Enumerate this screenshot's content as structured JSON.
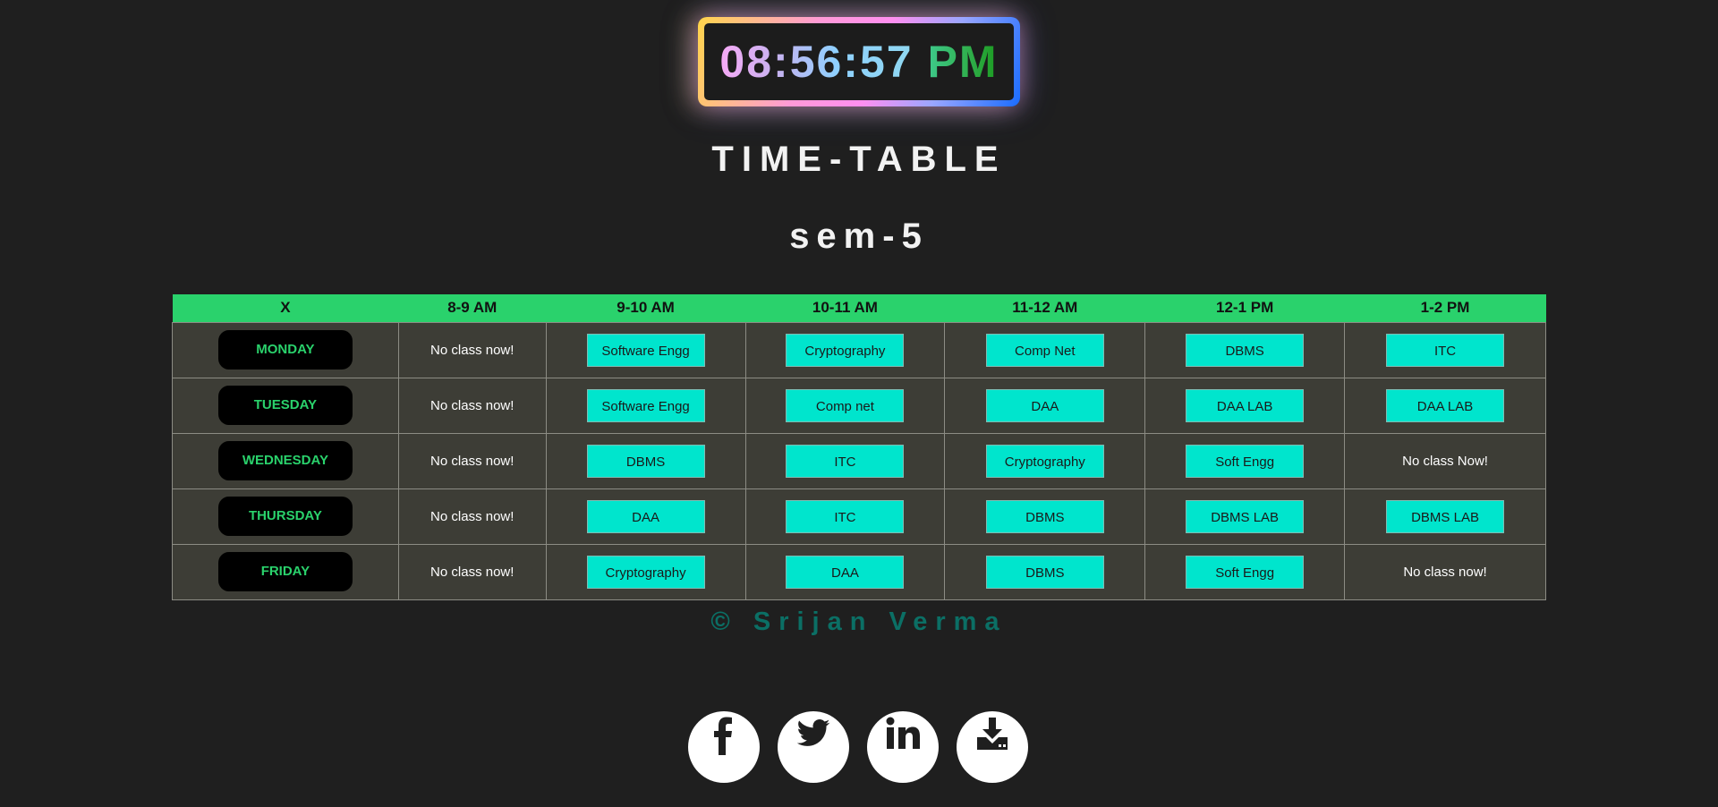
{
  "clock": {
    "time": "08:56:57",
    "ampm": "PM"
  },
  "title": "TIME-TABLE",
  "subtitle": "sem-5",
  "table": {
    "headers": [
      "X",
      "8-9 AM",
      "9-10 AM",
      "10-11 AM",
      "11-12 AM",
      "12-1 PM",
      "1-2 PM"
    ],
    "rows": [
      {
        "day": "MONDAY",
        "cells": [
          {
            "text": "No class now!",
            "type": "none"
          },
          {
            "text": "Software Engg",
            "type": "subject"
          },
          {
            "text": "Cryptography",
            "type": "subject"
          },
          {
            "text": "Comp Net",
            "type": "subject"
          },
          {
            "text": "DBMS",
            "type": "subject"
          },
          {
            "text": "ITC",
            "type": "subject"
          }
        ]
      },
      {
        "day": "TUESDAY",
        "cells": [
          {
            "text": "No class now!",
            "type": "none"
          },
          {
            "text": "Software Engg",
            "type": "subject"
          },
          {
            "text": "Comp net",
            "type": "subject"
          },
          {
            "text": "DAA",
            "type": "subject"
          },
          {
            "text": "DAA LAB",
            "type": "subject"
          },
          {
            "text": "DAA LAB",
            "type": "subject"
          }
        ]
      },
      {
        "day": "WEDNESDAY",
        "cells": [
          {
            "text": "No class now!",
            "type": "none"
          },
          {
            "text": "DBMS",
            "type": "subject"
          },
          {
            "text": "ITC",
            "type": "subject"
          },
          {
            "text": "Cryptography",
            "type": "subject"
          },
          {
            "text": "Soft Engg",
            "type": "subject"
          },
          {
            "text": "No class Now!",
            "type": "none"
          }
        ]
      },
      {
        "day": "THURSDAY",
        "cells": [
          {
            "text": "No class now!",
            "type": "none"
          },
          {
            "text": "DAA",
            "type": "subject"
          },
          {
            "text": "ITC",
            "type": "subject"
          },
          {
            "text": "DBMS",
            "type": "subject"
          },
          {
            "text": "DBMS LAB",
            "type": "subject"
          },
          {
            "text": "DBMS LAB",
            "type": "subject"
          }
        ]
      },
      {
        "day": "FRIDAY",
        "cells": [
          {
            "text": "No class now!",
            "type": "none"
          },
          {
            "text": "Cryptography",
            "type": "subject"
          },
          {
            "text": "DAA",
            "type": "subject"
          },
          {
            "text": "DBMS",
            "type": "subject"
          },
          {
            "text": "Soft Engg",
            "type": "subject"
          },
          {
            "text": "No class now!",
            "type": "none"
          }
        ]
      }
    ]
  },
  "copyright": "© Srijan Verma",
  "socials": [
    {
      "name": "facebook-icon"
    },
    {
      "name": "twitter-icon"
    },
    {
      "name": "linkedin-icon"
    },
    {
      "name": "download-icon"
    }
  ],
  "colors": {
    "background": "#1f1f1f",
    "header_green": "#2ad26c",
    "subject_cyan": "#00e5cd",
    "copyright_teal": "#0b6f65"
  }
}
